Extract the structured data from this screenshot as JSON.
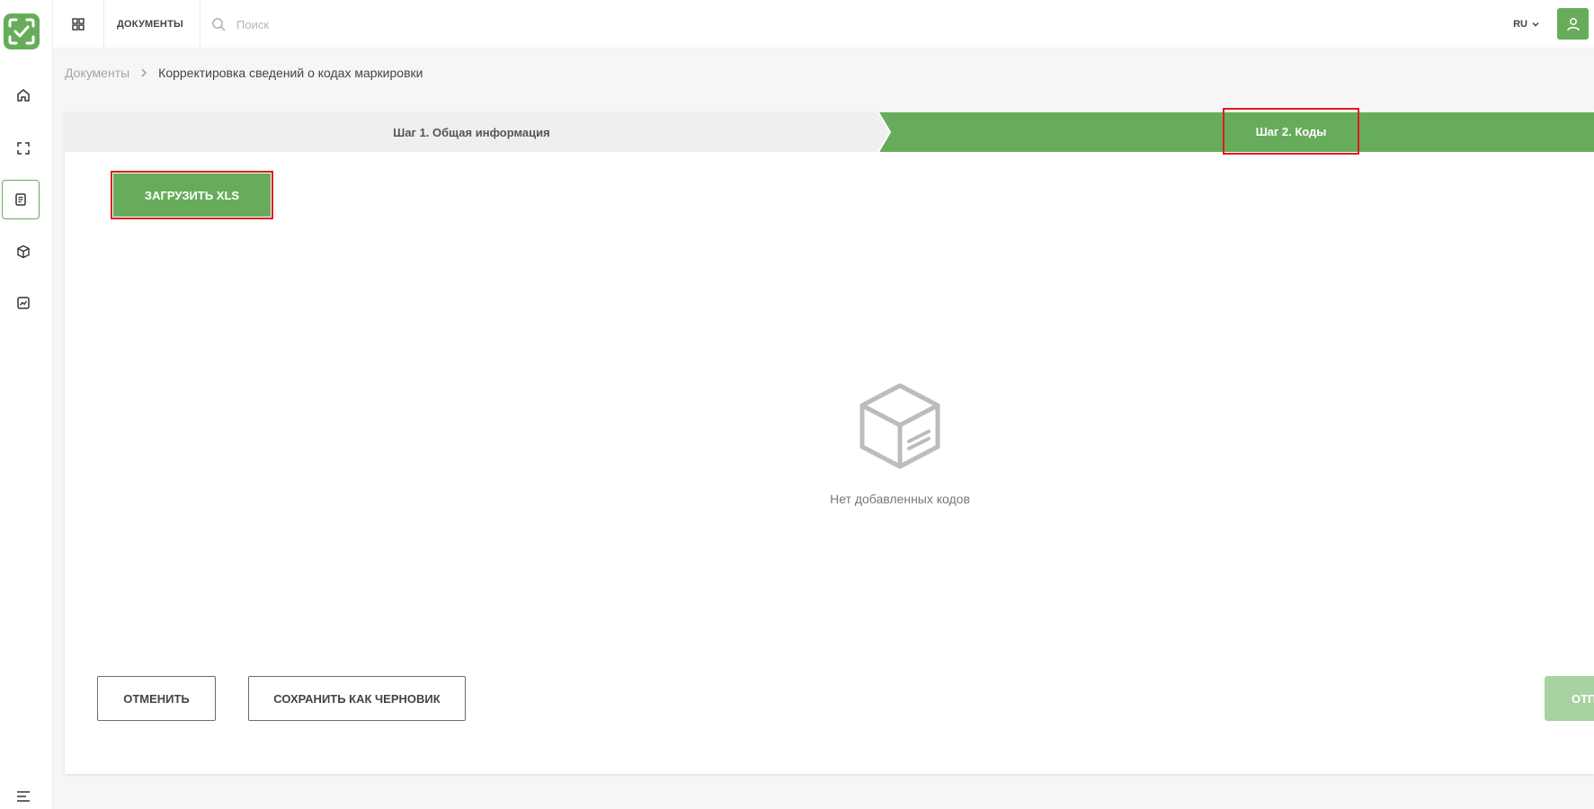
{
  "topbar": {
    "section_title": "ДОКУМЕНТЫ",
    "search_placeholder": "Поиск",
    "language": "RU"
  },
  "sidebar": {
    "items": [
      {
        "name": "home-icon",
        "active": false
      },
      {
        "name": "scan-icon",
        "active": false
      },
      {
        "name": "documents-icon",
        "active": true
      },
      {
        "name": "box-icon",
        "active": false
      },
      {
        "name": "reports-icon",
        "active": false
      },
      {
        "name": "menu-icon",
        "active": false
      }
    ]
  },
  "breadcrumb": {
    "parent": "Документы",
    "current": "Корректировка сведений о кодах маркировки"
  },
  "steps": {
    "step1": "Шаг 1. Общая информация",
    "step2": "Шаг 2. Коды"
  },
  "main": {
    "upload_button": "ЗАГРУЗИТЬ XLS",
    "empty_text": "Нет добавленных кодов"
  },
  "footer": {
    "cancel_button": "ОТМЕНИТЬ",
    "draft_button": "СОХРАНИТЬ КАК ЧЕРНОВИК",
    "send_button": "ОТП"
  },
  "colors": {
    "accent": "#67ac5b",
    "accent_disabled": "#a8d2a1",
    "highlight": "#e01b1b"
  }
}
